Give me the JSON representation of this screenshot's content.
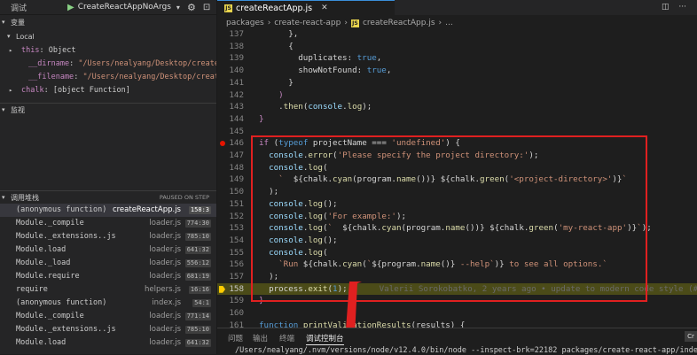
{
  "debug_toolbar": {
    "title": "调试",
    "config_name": "CreateReactAppNoArgs",
    "play_icon": "play-icon",
    "gear_icon": "gear-icon",
    "terminal_icon": "terminal-icon"
  },
  "variables": {
    "header": "变量",
    "local_header": "Local",
    "items": [
      {
        "name": "this",
        "value": "Object",
        "type": "obj"
      },
      {
        "name": "__dirname",
        "value": "\"/Users/nealyang/Desktop/create-rea",
        "type": "str"
      },
      {
        "name": "__filename",
        "value": "\"/Users/nealyang/Desktop/create-re",
        "type": "str"
      },
      {
        "name": "chalk",
        "value": "[object Function]",
        "type": "obj"
      }
    ]
  },
  "watch": {
    "header": "监视"
  },
  "callstack": {
    "header": "调用堆栈",
    "status": "PAUSED ON STEP",
    "frames": [
      {
        "fn": "(anonymous function)",
        "file": "createReactApp.js",
        "pos": "158:3",
        "active": true
      },
      {
        "fn": "Module._compile",
        "file": "loader.js",
        "pos": "774:30",
        "active": false
      },
      {
        "fn": "Module._extensions..js",
        "file": "loader.js",
        "pos": "785:10",
        "active": false
      },
      {
        "fn": "Module.load",
        "file": "loader.js",
        "pos": "641:32",
        "active": false
      },
      {
        "fn": "Module._load",
        "file": "loader.js",
        "pos": "556:12",
        "active": false
      },
      {
        "fn": "Module.require",
        "file": "loader.js",
        "pos": "681:19",
        "active": false
      },
      {
        "fn": "require",
        "file": "helpers.js",
        "pos": "16:16",
        "active": false
      },
      {
        "fn": "(anonymous function)",
        "file": "index.js",
        "pos": "54:1",
        "active": false
      },
      {
        "fn": "Module._compile",
        "file": "loader.js",
        "pos": "771:14",
        "active": false
      },
      {
        "fn": "Module._extensions..js",
        "file": "loader.js",
        "pos": "785:10",
        "active": false
      },
      {
        "fn": "Module.load",
        "file": "loader.js",
        "pos": "641:32",
        "active": false
      }
    ]
  },
  "editor": {
    "tab_label": "createReactApp.js",
    "tab_icon": "js-file-icon",
    "breadcrumb": [
      "packages",
      "create-react-app",
      "createReactApp.js",
      "..."
    ],
    "blame": "Valerii Sorokobatko, 2 years ago • update to modern code style (#17",
    "current_line": "158",
    "breakpoint_line": "146"
  },
  "code_lines": [
    {
      "n": "137",
      "tokens": [
        [
          "p",
          "      },"
        ]
      ]
    },
    {
      "n": "138",
      "tokens": [
        [
          "p",
          "      {"
        ]
      ]
    },
    {
      "n": "139",
      "tokens": [
        [
          "p",
          "        duplicates: "
        ],
        [
          "b",
          "true"
        ],
        [
          "p",
          ","
        ]
      ]
    },
    {
      "n": "140",
      "tokens": [
        [
          "p",
          "        showNotFound: "
        ],
        [
          "b",
          "true"
        ],
        [
          "p",
          ","
        ]
      ]
    },
    {
      "n": "141",
      "tokens": [
        [
          "p",
          "      }"
        ]
      ]
    },
    {
      "n": "142",
      "tokens": [
        [
          "k",
          "    )"
        ]
      ]
    },
    {
      "n": "143",
      "tokens": [
        [
          "p",
          "    ."
        ],
        [
          "f",
          "then"
        ],
        [
          "p",
          "("
        ],
        [
          "v",
          "console"
        ],
        [
          "p",
          "."
        ],
        [
          "f",
          "log"
        ],
        [
          "p",
          ");"
        ]
      ]
    },
    {
      "n": "144",
      "tokens": [
        [
          "k",
          "}"
        ]
      ]
    },
    {
      "n": "145",
      "tokens": [
        [
          "p",
          ""
        ]
      ]
    },
    {
      "n": "146",
      "tokens": [
        [
          "k",
          "if"
        ],
        [
          "p",
          " ("
        ],
        [
          "b",
          "typeof"
        ],
        [
          "p",
          " projectName === "
        ],
        [
          "s",
          "'undefined'"
        ],
        [
          "p",
          ") {"
        ]
      ]
    },
    {
      "n": "147",
      "tokens": [
        [
          "p",
          "  "
        ],
        [
          "v",
          "console"
        ],
        [
          "p",
          "."
        ],
        [
          "f",
          "error"
        ],
        [
          "p",
          "("
        ],
        [
          "s",
          "'Please specify the project directory:'"
        ],
        [
          "p",
          ");"
        ]
      ]
    },
    {
      "n": "148",
      "tokens": [
        [
          "p",
          "  "
        ],
        [
          "v",
          "console"
        ],
        [
          "p",
          "."
        ],
        [
          "f",
          "log"
        ],
        [
          "p",
          "("
        ]
      ]
    },
    {
      "n": "149",
      "tokens": [
        [
          "s",
          "    `  "
        ],
        [
          "p",
          "${chalk."
        ],
        [
          "f",
          "cyan"
        ],
        [
          "p",
          "(program."
        ],
        [
          "f",
          "name"
        ],
        [
          "p",
          "())} ${chalk."
        ],
        [
          "f",
          "green"
        ],
        [
          "p",
          "("
        ],
        [
          "s",
          "'<project-directory>'"
        ],
        [
          "p",
          ")}"
        ],
        [
          "s",
          "`"
        ]
      ]
    },
    {
      "n": "150",
      "tokens": [
        [
          "p",
          "  );"
        ]
      ]
    },
    {
      "n": "151",
      "tokens": [
        [
          "p",
          "  "
        ],
        [
          "v",
          "console"
        ],
        [
          "p",
          "."
        ],
        [
          "f",
          "log"
        ],
        [
          "p",
          "();"
        ]
      ]
    },
    {
      "n": "152",
      "tokens": [
        [
          "p",
          "  "
        ],
        [
          "v",
          "console"
        ],
        [
          "p",
          "."
        ],
        [
          "f",
          "log"
        ],
        [
          "p",
          "("
        ],
        [
          "s",
          "'For example:'"
        ],
        [
          "p",
          ");"
        ]
      ]
    },
    {
      "n": "153",
      "tokens": [
        [
          "p",
          "  "
        ],
        [
          "v",
          "console"
        ],
        [
          "p",
          "."
        ],
        [
          "f",
          "log"
        ],
        [
          "p",
          "("
        ],
        [
          "s",
          "`  "
        ],
        [
          "p",
          "${chalk."
        ],
        [
          "f",
          "cyan"
        ],
        [
          "p",
          "(program."
        ],
        [
          "f",
          "name"
        ],
        [
          "p",
          "())} ${chalk."
        ],
        [
          "f",
          "green"
        ],
        [
          "p",
          "("
        ],
        [
          "s",
          "'my-react-app'"
        ],
        [
          "p",
          ")}"
        ],
        [
          "s",
          "`"
        ],
        [
          "p",
          ");"
        ]
      ]
    },
    {
      "n": "154",
      "tokens": [
        [
          "p",
          "  "
        ],
        [
          "v",
          "console"
        ],
        [
          "p",
          "."
        ],
        [
          "f",
          "log"
        ],
        [
          "p",
          "();"
        ]
      ]
    },
    {
      "n": "155",
      "tokens": [
        [
          "p",
          "  "
        ],
        [
          "v",
          "console"
        ],
        [
          "p",
          "."
        ],
        [
          "f",
          "log"
        ],
        [
          "p",
          "("
        ]
      ]
    },
    {
      "n": "156",
      "tokens": [
        [
          "s",
          "    `Run "
        ],
        [
          "p",
          "${chalk."
        ],
        [
          "f",
          "cyan"
        ],
        [
          "p",
          "("
        ],
        [
          "s",
          "`"
        ],
        [
          "p",
          "${program."
        ],
        [
          "f",
          "name"
        ],
        [
          "p",
          "()}"
        ],
        [
          "s",
          " --help`"
        ],
        [
          "p",
          ")}"
        ],
        [
          "s",
          " to see all options.`"
        ]
      ]
    },
    {
      "n": "157",
      "tokens": [
        [
          "p",
          "  );"
        ]
      ]
    },
    {
      "n": "158",
      "tokens": [
        [
          "p",
          "  process."
        ],
        [
          "f",
          "exit"
        ],
        [
          "p",
          "("
        ],
        [
          "b",
          "1"
        ],
        [
          "p",
          ");"
        ]
      ]
    },
    {
      "n": "159",
      "tokens": [
        [
          "k",
          "}"
        ]
      ]
    },
    {
      "n": "160",
      "tokens": [
        [
          "p",
          ""
        ]
      ]
    },
    {
      "n": "161",
      "tokens": [
        [
          "b",
          "function"
        ],
        [
          "p",
          " "
        ],
        [
          "f",
          "printValidationResults"
        ],
        [
          "p",
          "(results) {"
        ]
      ]
    }
  ],
  "panel": {
    "tabs": [
      "问题",
      "输出",
      "终端",
      "调试控制台"
    ],
    "active_tab": 3,
    "terminal_line": "/Users/nealyang/.nvm/versions/node/v12.4.0/bin/node --inspect-brk=22182 packages/create-react-app/index.js",
    "corner_button": "Cr"
  }
}
